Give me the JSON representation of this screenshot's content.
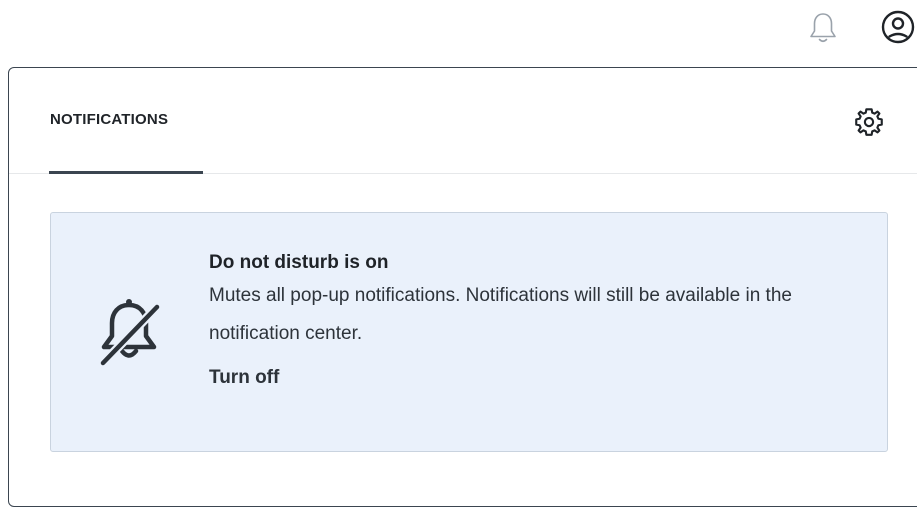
{
  "topbar": {
    "notifications_icon": "bell-icon",
    "account_icon": "user-circle-icon"
  },
  "panel": {
    "tab_label": "NOTIFICATIONS",
    "settings_icon": "gear-icon"
  },
  "dnd": {
    "icon": "bell-off-icon",
    "title": "Do not disturb is on",
    "description": "Mutes all pop-up notifications. Notifications will still be available in the notification center.",
    "action_label": "Turn off",
    "background_color": "#eaf1fb"
  }
}
